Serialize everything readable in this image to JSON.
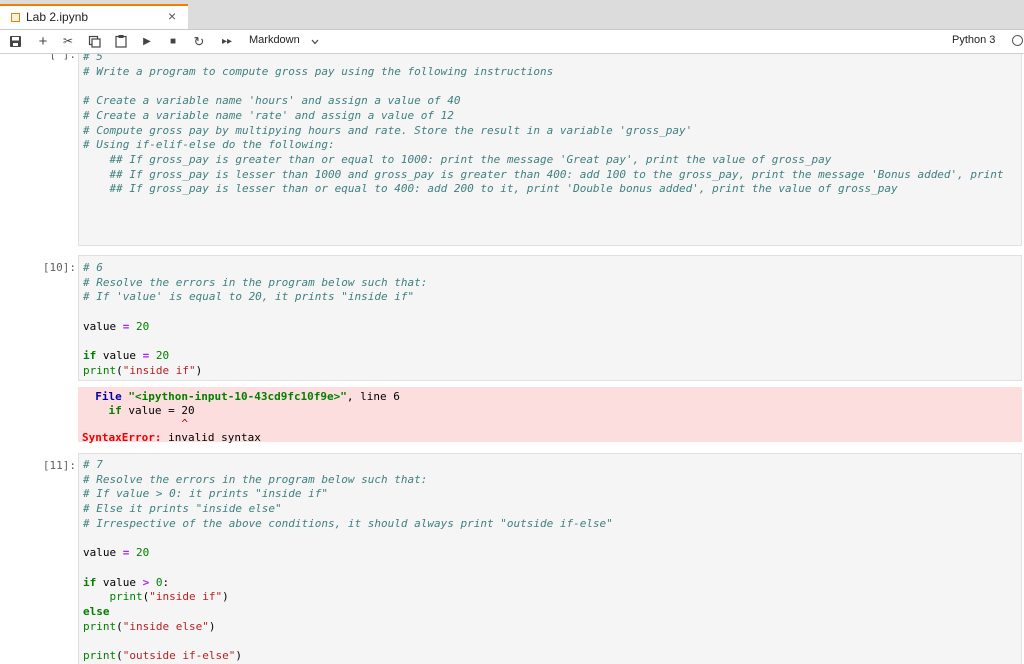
{
  "tab": {
    "title": "Lab 2.ipynb",
    "close": "×"
  },
  "toolbar": {
    "save": "🖫",
    "add": "+",
    "cut": "✂",
    "copy": "⧉",
    "paste": "📋",
    "run": "▶",
    "stop": "■",
    "restart": "↻",
    "fast_forward": "▸▸",
    "cell_type": "Markdown",
    "kernel": "Python 3"
  },
  "cells": [
    {
      "prompt": "[ ]:",
      "lines": [
        "# 5",
        "# Write a program to compute gross pay using the following instructions",
        "",
        "# Create a variable name 'hours' and assign a value of 40",
        "# Create a variable name 'rate' and assign a value of 12",
        "# Compute gross pay by multipying hours and rate. Store the result in a variable 'gross_pay'",
        "# Using if-elif-else do the following:",
        "    ## If gross_pay is greater than or equal to 1000: print the message 'Great pay', print the value of gross_pay",
        "    ## If gross_pay is lesser than 1000 and gross_pay is greater than 400: add 100 to the gross_pay, print the message 'Bonus added', print",
        "    ## If gross_pay is lesser than or equal to 400: add 200 to it, print 'Double bonus added', print the value of gross_pay"
      ]
    },
    {
      "prompt": "[10]:",
      "comments": [
        "# 6",
        "# Resolve the errors in the program below such that:",
        "# If 'value' is equal to 20, it prints \"inside if\""
      ],
      "assign": {
        "name": "value",
        "op": "=",
        "val": "20"
      },
      "if_line": {
        "kw": "if",
        "name": "value",
        "op": "=",
        "val": "20",
        "colon": ""
      },
      "print_line": {
        "fn": "print",
        "open": "(",
        "arg": "\"inside if\"",
        "close": ")"
      },
      "error": {
        "file_label": "File",
        "file_name": "\"<ipython-input-10-43cd9fc10f9e>\"",
        "line_info": ", line 6",
        "code_kw": "if",
        "code_rest": " value = 20",
        "caret": "^",
        "type": "SyntaxError:",
        "message": " invalid syntax"
      }
    },
    {
      "prompt": "[11]:",
      "comments": [
        "# 7",
        "# Resolve the errors in the program below such that:",
        "# If value > 0: it prints \"inside if\"",
        "# Else it prints \"inside else\"",
        "# Irrespective of the above conditions, it should always print \"outside if-else\""
      ],
      "assign": {
        "name": "value",
        "op": "=",
        "val": "20"
      },
      "if_line": {
        "kw": "if",
        "name": "value",
        "op": ">",
        "val": "0",
        "colon": ":"
      },
      "print_if": {
        "fn": "print",
        "arg": "\"inside if\""
      },
      "else_kw": "else",
      "print_else": {
        "fn": "print",
        "arg": "\"inside else\""
      },
      "print_outside": {
        "fn": "print",
        "arg": "\"outside if-else\""
      }
    }
  ]
}
